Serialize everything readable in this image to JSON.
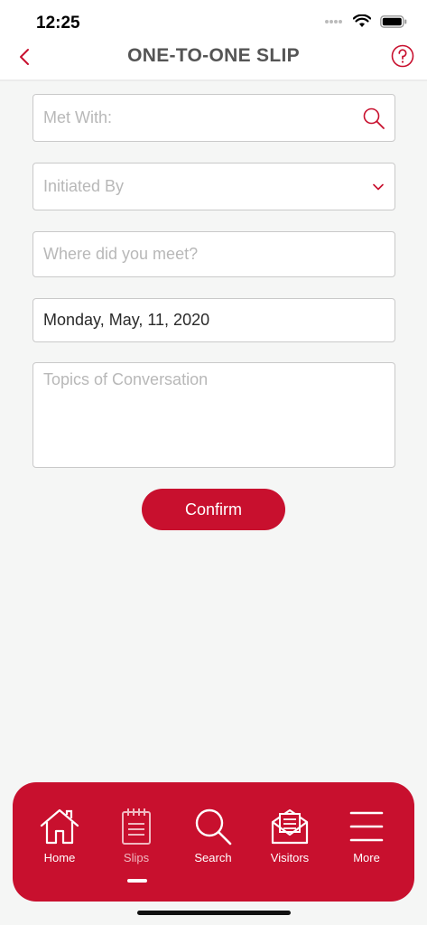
{
  "status_bar": {
    "time": "12:25"
  },
  "header": {
    "title": "ONE-TO-ONE SLIP"
  },
  "form": {
    "met_with": {
      "placeholder": "Met With:"
    },
    "initiated_by": {
      "placeholder": "Initiated By"
    },
    "where_met": {
      "placeholder": "Where did you meet?"
    },
    "date": {
      "value": "Monday, May, 11, 2020"
    },
    "topics": {
      "placeholder": "Topics of Conversation"
    },
    "confirm_label": "Confirm"
  },
  "tabbar": {
    "items": [
      {
        "label": "Home",
        "icon": "home-icon"
      },
      {
        "label": "Slips",
        "icon": "notepad-icon",
        "active": true
      },
      {
        "label": "Search",
        "icon": "search-icon"
      },
      {
        "label": "Visitors",
        "icon": "envelope-icon"
      },
      {
        "label": "More",
        "icon": "menu-icon"
      }
    ]
  },
  "colors": {
    "accent": "#c8102e",
    "background": "#f5f6f5"
  }
}
